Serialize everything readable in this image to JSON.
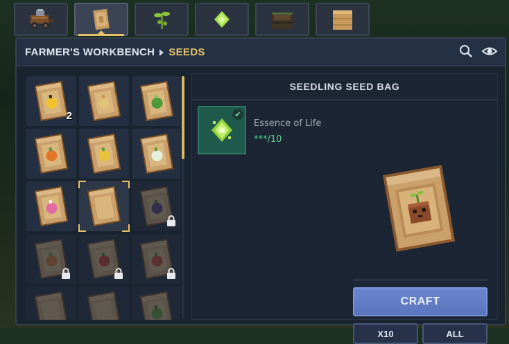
{
  "tabs": [
    {
      "icon": "cart-icon",
      "active": false
    },
    {
      "icon": "seed-bag-icon",
      "active": true
    },
    {
      "icon": "sprout-icon",
      "active": false
    },
    {
      "icon": "essence-gem-icon",
      "active": false
    },
    {
      "icon": "planter-box-icon",
      "active": false
    },
    {
      "icon": "wood-block-icon",
      "active": false
    }
  ],
  "breadcrumb": {
    "workbench": "FARMER'S WORKBENCH",
    "category": "SEEDS"
  },
  "header_icons": [
    "search-icon",
    "eye-icon"
  ],
  "seeds": [
    {
      "name": "sunflower-seed-bag",
      "symbol": "sunflower",
      "quantity": "2",
      "locked": false,
      "selected": false
    },
    {
      "name": "wheat-seed-bag",
      "symbol": "wheat",
      "quantity": "",
      "locked": false,
      "selected": false
    },
    {
      "name": "cabbage-seed-bag",
      "symbol": "cabbage",
      "quantity": "",
      "locked": false,
      "selected": false
    },
    {
      "name": "carrot-seed-bag",
      "symbol": "carrot",
      "quantity": "",
      "locked": false,
      "selected": false
    },
    {
      "name": "corn-seed-bag",
      "symbol": "corn",
      "quantity": "",
      "locked": false,
      "selected": false
    },
    {
      "name": "cauliflower-seed-bag",
      "symbol": "cauliflower",
      "quantity": "",
      "locked": false,
      "selected": false
    },
    {
      "name": "radish-seed-bag",
      "symbol": "radish",
      "quantity": "",
      "locked": false,
      "selected": false
    },
    {
      "name": "seedling-seed-bag",
      "symbol": "seedling",
      "quantity": "",
      "locked": false,
      "selected": true
    },
    {
      "name": "eggplant-seed-bag",
      "symbol": "eggplant",
      "quantity": "",
      "locked": true,
      "selected": false
    },
    {
      "name": "pumpkin-seed-bag",
      "symbol": "pumpkin",
      "quantity": "",
      "locked": true,
      "selected": false
    },
    {
      "name": "tomato-seed-bag",
      "symbol": "tomato",
      "quantity": "",
      "locked": true,
      "selected": false
    },
    {
      "name": "chili-seed-bag",
      "symbol": "chili",
      "quantity": "",
      "locked": true,
      "selected": false
    },
    {
      "name": "seed-bag-13",
      "symbol": "",
      "quantity": "",
      "locked": true,
      "selected": false
    },
    {
      "name": "seed-bag-14",
      "symbol": "",
      "quantity": "",
      "locked": true,
      "selected": false
    },
    {
      "name": "seed-bag-15",
      "symbol": "sprout",
      "quantity": "",
      "locked": true,
      "selected": false
    }
  ],
  "detail": {
    "title": "SEEDLING SEED BAG",
    "ingredient": {
      "name": "Essence of Life",
      "count": "***/10",
      "icon": "essence-gem-icon",
      "satisfied": true
    },
    "craft_label": "CRAFT",
    "x10_label": "X10",
    "all_label": "ALL"
  },
  "colors": {
    "accent": "#e6c36a",
    "craft": "#6b86cf",
    "ingredient_ok": "#54d68e",
    "panel": "#1a2330"
  }
}
